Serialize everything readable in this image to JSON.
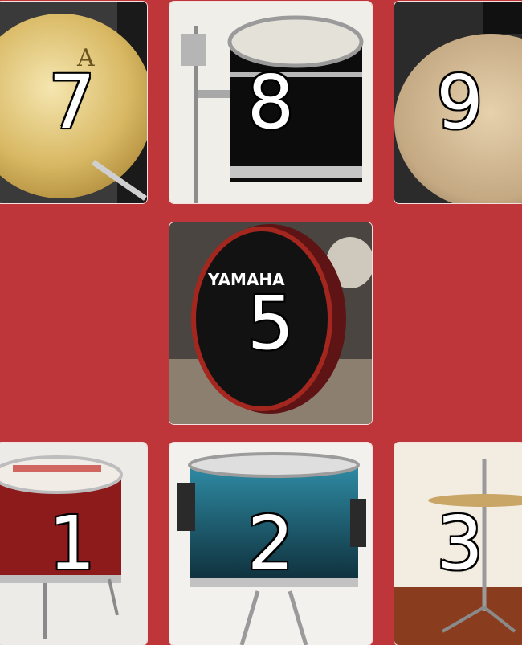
{
  "pads": [
    {
      "id": "t7",
      "label": "7",
      "instrument": "cymbal"
    },
    {
      "id": "t8",
      "label": "8",
      "instrument": "tom"
    },
    {
      "id": "t9",
      "label": "9",
      "instrument": "cymbal"
    },
    {
      "id": "t5",
      "label": "5",
      "instrument": "bass-drum",
      "brand_text": "YAMAHA"
    },
    {
      "id": "t1",
      "label": "1",
      "instrument": "floor-tom"
    },
    {
      "id": "t2",
      "label": "2",
      "instrument": "snare-drum"
    },
    {
      "id": "t3",
      "label": "3",
      "instrument": "hi-hat"
    }
  ],
  "colors": {
    "background": "#bf363a"
  }
}
